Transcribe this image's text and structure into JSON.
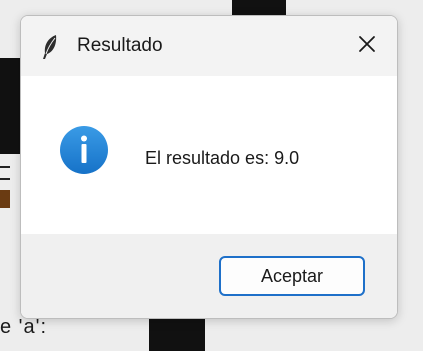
{
  "background": {
    "text_fragment": "e 'a':"
  },
  "dialog": {
    "title": "Resultado",
    "app_icon": "feather-icon",
    "close_icon": "close-icon",
    "info_icon": "info-icon",
    "message": "El resultado es: 9.0",
    "ok_label": "Aceptar",
    "colors": {
      "accent": "#1e70c9",
      "info_icon": "#1a7fd6",
      "titlebar": "#f3f3f3",
      "footer": "#f0f0f0"
    }
  }
}
